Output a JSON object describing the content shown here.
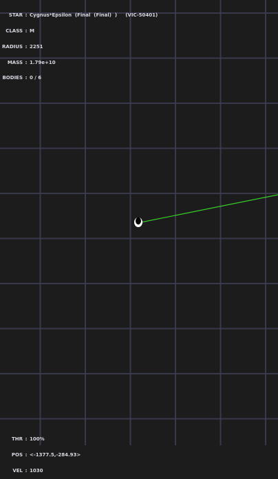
{
  "star_info": {
    "star": {
      "label": "STAR",
      "value": "Cygnus*Epsilon  (Final  (Final)  )     (VIC-50401)"
    },
    "class": {
      "label": "CLASS",
      "value": "M"
    },
    "radius": {
      "label": "RADIUS",
      "value": "2251"
    },
    "mass": {
      "label": "MASS",
      "value": "1.79e+10"
    },
    "bodies": {
      "label": "BODIES",
      "value": "0 / 6"
    }
  },
  "ship_status": {
    "thrust": {
      "label": "THR",
      "value": "100%"
    },
    "position": {
      "label": "POS",
      "value": "<-1377.5,-284.93>"
    },
    "velocity": {
      "label": "VEL",
      "value": "1030"
    }
  },
  "colors": {
    "background": "#1c1c1c",
    "grid": "#3e3e54",
    "hud_text": "#d8d8e2",
    "trajectory": "#39d12a",
    "ship": "#ffffff"
  }
}
